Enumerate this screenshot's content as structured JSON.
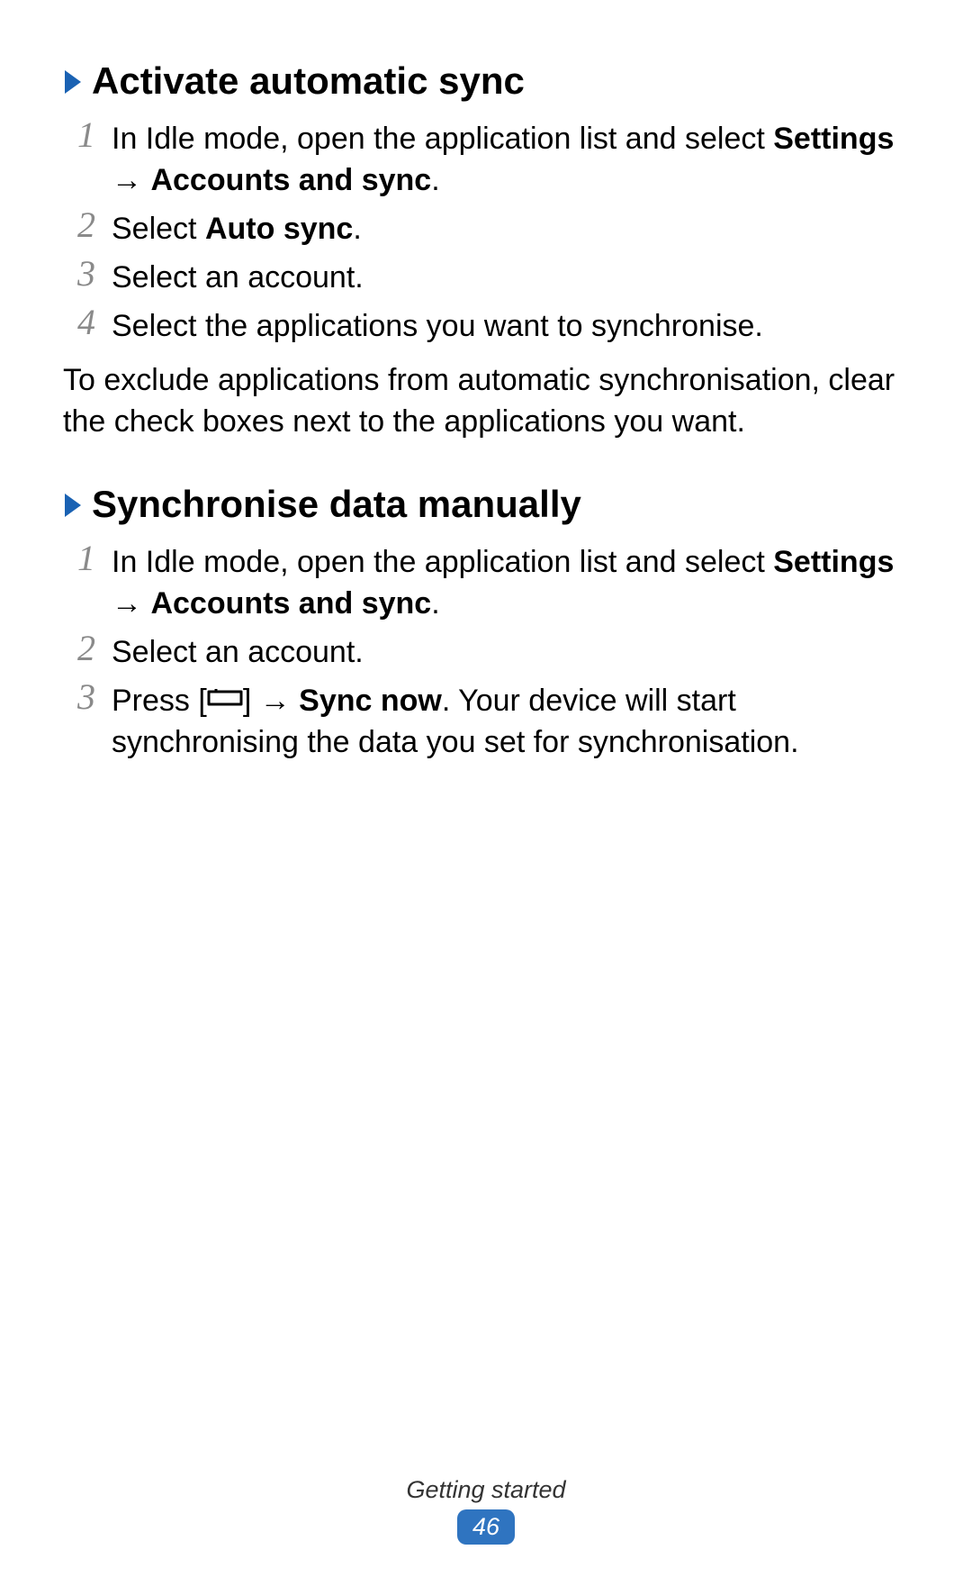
{
  "section1": {
    "title": "Activate automatic sync",
    "steps": [
      {
        "num": "1",
        "pre": "In Idle mode, open the application list and select ",
        "b1": "Settings",
        "mid": " → ",
        "b2": "Accounts and sync",
        "post": "."
      },
      {
        "num": "2",
        "pre": "Select ",
        "b1": "Auto sync",
        "post": "."
      },
      {
        "num": "3",
        "pre": "Select an account."
      },
      {
        "num": "4",
        "pre": "Select the applications you want to synchronise."
      }
    ],
    "note": "To exclude applications from automatic synchronisation, clear the check boxes next to the applications you want."
  },
  "section2": {
    "title": "Synchronise data manually",
    "steps": [
      {
        "num": "1",
        "pre": "In Idle mode, open the application list and select ",
        "b1": "Settings",
        "mid": " → ",
        "b2": "Accounts and sync",
        "post": "."
      },
      {
        "num": "2",
        "pre": "Select an account."
      },
      {
        "num": "3",
        "pre": "Press [",
        "iconAfterPre": true,
        "mid": "] → ",
        "b1": "Sync now",
        "post": ". Your device will start synchronising the data you set for synchronisation."
      }
    ]
  },
  "footer": {
    "label": "Getting started",
    "page": "46"
  },
  "icons": {
    "menu_label": "menu-icon"
  }
}
